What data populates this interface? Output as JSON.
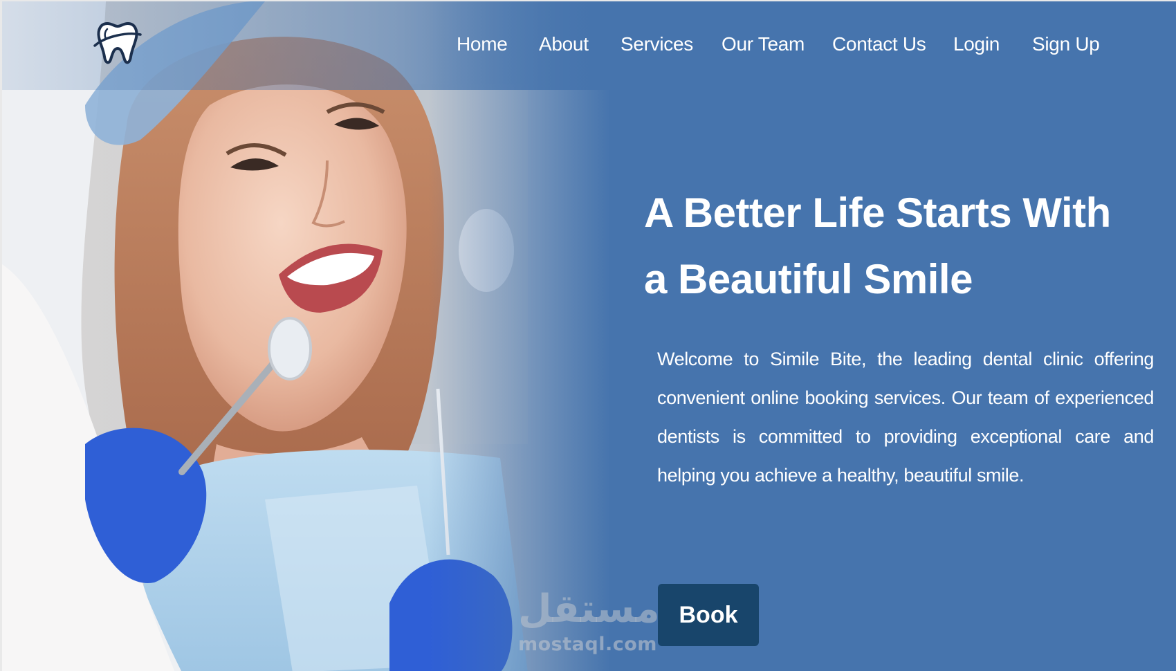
{
  "brand": {
    "logo_icon": "tooth-icon",
    "primary_color": "#4674ad",
    "button_color": "#18456b"
  },
  "nav": {
    "items": [
      {
        "label": "Home"
      },
      {
        "label": "About"
      },
      {
        "label": "Services"
      },
      {
        "label": "Our Team"
      },
      {
        "label": "Contact Us"
      },
      {
        "label": "Login"
      },
      {
        "label": "Sign Up"
      }
    ]
  },
  "hero": {
    "title": "A Better Life Starts With a Beautiful Smile",
    "description": "Welcome to Simile Bite, the leading dental clinic offering convenient online booking services. Our team of experienced dentists is committed to providing exceptional care and helping you achieve a healthy, beautiful smile.",
    "button_label": "Book",
    "image": "smiling-patient-dental-checkup"
  },
  "watermark": {
    "arabic": "مستقل",
    "latin": "mostaql.com"
  }
}
